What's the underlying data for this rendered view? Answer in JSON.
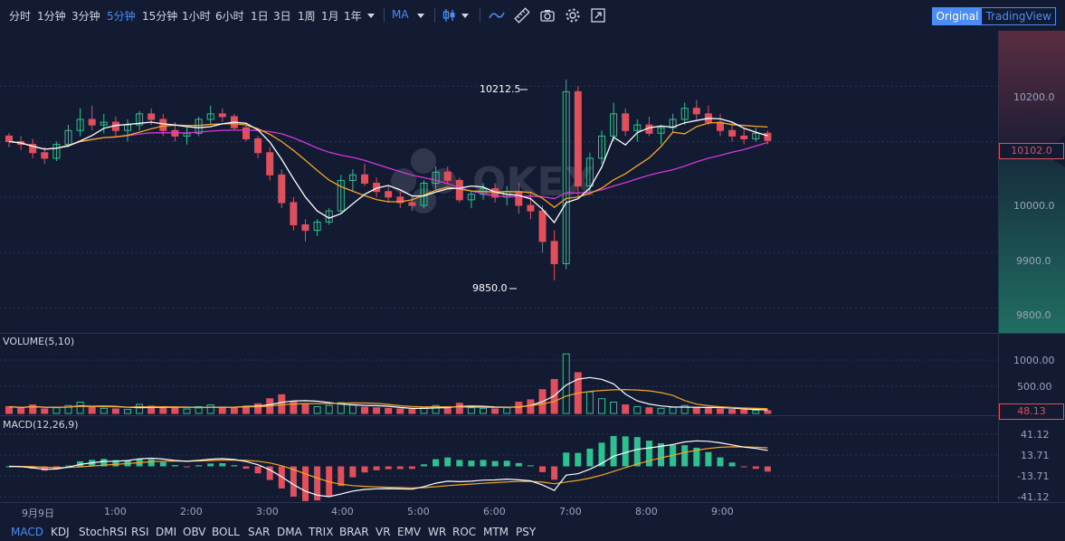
{
  "toolbar": {
    "intervals": [
      "分时",
      "1分钟",
      "3分钟",
      "5分钟",
      "15分钟",
      "1小时",
      "6小时",
      "1日",
      "3日",
      "1周",
      "1月",
      "1年"
    ],
    "active_interval": "5分钟",
    "indicator_select": "MA",
    "mode_original": "Original",
    "mode_tradingview": "TradingView",
    "icons": [
      "candle-type-icon",
      "line-tool-icon",
      "ruler-icon",
      "camera-icon",
      "settings-gear-icon",
      "fullscreen-icon"
    ]
  },
  "watermark": "OKEX",
  "main_pane": {
    "price_ticks": [
      "10200.0",
      "10000.0",
      "9900.0",
      "9800.0"
    ],
    "current_price": "10102.0",
    "high_annotation": "10212.5",
    "low_annotation": "9850.0"
  },
  "volume_pane": {
    "label": "VOLUME(5,10)",
    "ticks": [
      "1000.00",
      "500.00"
    ],
    "current": "48.13"
  },
  "macd_pane": {
    "label": "MACD(12,26,9)",
    "ticks": [
      "41.12",
      "13.71",
      "-13.71",
      "-41.12"
    ]
  },
  "time_axis": [
    "9月9日",
    "1:00",
    "2:00",
    "3:00",
    "4:00",
    "5:00",
    "6:00",
    "7:00",
    "8:00",
    "9:00"
  ],
  "bottom_indicators": [
    "MACD",
    "KDJ",
    "StochRSI",
    "RSI",
    "DMI",
    "OBV",
    "BOLL",
    "SAR",
    "DMA",
    "TRIX",
    "BRAR",
    "VR",
    "EMV",
    "WR",
    "ROC",
    "MTM",
    "PSY"
  ],
  "active_bottom_indicator": "MACD",
  "colors": {
    "background": "#131b33",
    "up": "#2ec08f",
    "down": "#e0505c",
    "accent": "#4c8cf5",
    "ma_white": "#ffffff",
    "ma_orange": "#f5a623",
    "ma_magenta": "#d13ad6"
  },
  "chart_data": {
    "type": "candlestick",
    "y_range": [
      9760,
      10290
    ],
    "candles": [
      [
        10110,
        10115,
        10090,
        10100
      ],
      [
        10100,
        10110,
        10085,
        10095
      ],
      [
        10095,
        10105,
        10070,
        10080
      ],
      [
        10080,
        10090,
        10060,
        10070
      ],
      [
        10070,
        10100,
        10065,
        10095
      ],
      [
        10095,
        10130,
        10090,
        10120
      ],
      [
        10120,
        10160,
        10110,
        10140
      ],
      [
        10140,
        10165,
        10120,
        10130
      ],
      [
        10130,
        10150,
        10115,
        10135
      ],
      [
        10135,
        10145,
        10110,
        10120
      ],
      [
        10120,
        10140,
        10100,
        10130
      ],
      [
        10130,
        10155,
        10120,
        10150
      ],
      [
        10150,
        10160,
        10130,
        10140
      ],
      [
        10140,
        10150,
        10110,
        10120
      ],
      [
        10120,
        10135,
        10100,
        10110
      ],
      [
        10110,
        10125,
        10095,
        10115
      ],
      [
        10115,
        10145,
        10110,
        10140
      ],
      [
        10140,
        10165,
        10130,
        10150
      ],
      [
        10150,
        10160,
        10135,
        10145
      ],
      [
        10145,
        10150,
        10120,
        10125
      ],
      [
        10125,
        10130,
        10100,
        10105
      ],
      [
        10105,
        10110,
        10070,
        10080
      ],
      [
        10080,
        10090,
        10030,
        10040
      ],
      [
        10040,
        10050,
        9980,
        9990
      ],
      [
        9990,
        10000,
        9940,
        9950
      ],
      [
        9950,
        9960,
        9920,
        9940
      ],
      [
        9940,
        9960,
        9930,
        9955
      ],
      [
        9955,
        9980,
        9950,
        9975
      ],
      [
        9975,
        10040,
        9970,
        10030
      ],
      [
        10030,
        10050,
        10010,
        10040
      ],
      [
        10040,
        10060,
        10020,
        10025
      ],
      [
        10025,
        10035,
        10000,
        10010
      ],
      [
        10010,
        10020,
        9990,
        10000
      ],
      [
        10000,
        10010,
        9980,
        9990
      ],
      [
        9990,
        10000,
        9975,
        9985
      ],
      [
        9985,
        10030,
        9980,
        10025
      ],
      [
        10025,
        10055,
        10015,
        10045
      ],
      [
        10045,
        10055,
        10025,
        10030
      ],
      [
        10030,
        10035,
        9990,
        9995
      ],
      [
        9995,
        10010,
        9980,
        10005
      ],
      [
        10005,
        10025,
        9995,
        10015
      ],
      [
        10015,
        10025,
        9990,
        10000
      ],
      [
        10000,
        10020,
        9985,
        10010
      ],
      [
        10010,
        10025,
        9970,
        9985
      ],
      [
        9985,
        10010,
        9960,
        9975
      ],
      [
        9975,
        9985,
        9900,
        9920
      ],
      [
        9920,
        9940,
        9850,
        9880
      ],
      [
        9880,
        10212,
        9870,
        10190
      ],
      [
        10190,
        10200,
        10000,
        10020
      ],
      [
        10020,
        10080,
        10010,
        10070
      ],
      [
        10070,
        10120,
        10060,
        10110
      ],
      [
        10110,
        10170,
        10100,
        10150
      ],
      [
        10150,
        10160,
        10110,
        10120
      ],
      [
        10120,
        10140,
        10100,
        10130
      ],
      [
        10130,
        10145,
        10110,
        10115
      ],
      [
        10115,
        10130,
        10095,
        10125
      ],
      [
        10125,
        10150,
        10115,
        10140
      ],
      [
        10140,
        10170,
        10130,
        10160
      ],
      [
        10160,
        10175,
        10140,
        10150
      ],
      [
        10150,
        10165,
        10130,
        10135
      ],
      [
        10135,
        10150,
        10110,
        10120
      ],
      [
        10120,
        10135,
        10100,
        10110
      ],
      [
        10110,
        10125,
        10095,
        10105
      ],
      [
        10105,
        10125,
        10100,
        10115
      ],
      [
        10115,
        10120,
        10095,
        10102
      ]
    ],
    "volumes": [
      120,
      90,
      150,
      80,
      100,
      140,
      200,
      110,
      90,
      80,
      70,
      160,
      130,
      100,
      90,
      80,
      120,
      150,
      110,
      95,
      130,
      170,
      260,
      330,
      210,
      160,
      120,
      140,
      190,
      150,
      110,
      100,
      90,
      80,
      70,
      110,
      140,
      120,
      180,
      100,
      90,
      80,
      100,
      200,
      240,
      420,
      600,
      1050,
      720,
      380,
      260,
      200,
      150,
      120,
      100,
      90,
      110,
      140,
      100,
      90,
      80,
      70,
      60,
      55,
      48
    ]
  }
}
